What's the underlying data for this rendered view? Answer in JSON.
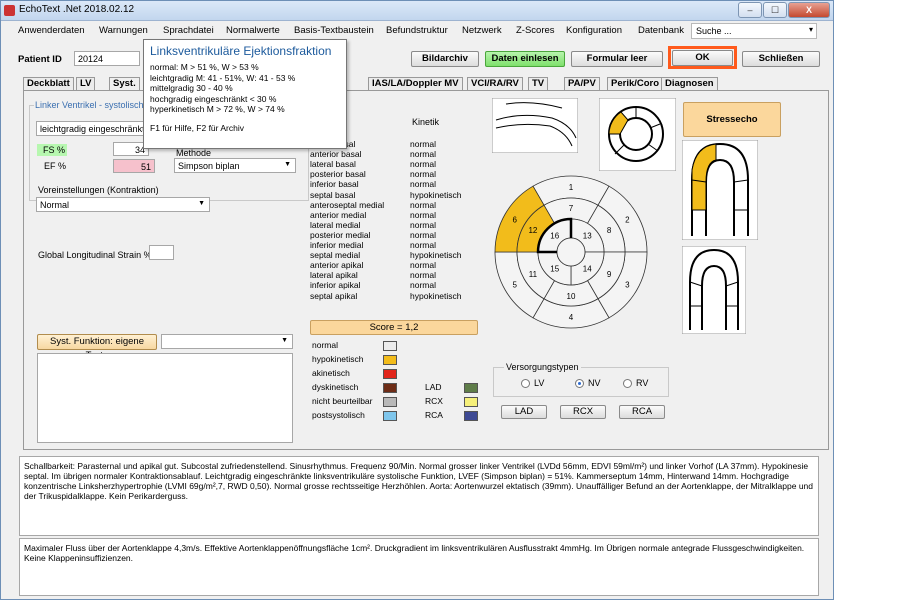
{
  "window": {
    "title": "EchoText .Net 2018.02.12",
    "min": "–",
    "max": "☐",
    "close": "X"
  },
  "menu": [
    "Anwenderdaten",
    "Warnungen",
    "Sprachdatei",
    "Normalwerte",
    "Basis-Textbaustein",
    "Befundstruktur",
    "Netzwerk",
    "Z-Scores",
    "Konfiguration",
    "Datenbank"
  ],
  "search": {
    "value": "Suche ..."
  },
  "patient": {
    "label": "Patient ID",
    "value": "20124"
  },
  "toolbar": {
    "bildarchiv": "Bildarchiv",
    "daten": "Daten einlesen",
    "formular": "Formular leer",
    "ok": "OK",
    "schliessen": "Schließen"
  },
  "tabs": [
    "Deckblatt",
    "LV",
    "Syst.",
    "IAS/LA/Doppler MV",
    "VCI/RA/RV",
    "TV",
    "PA/PV",
    "Perik/Coro",
    "Diagnosen"
  ],
  "tooltip": {
    "title": "Linksventrikuläre Ejektionsfraktion",
    "lines": [
      "normal: M > 51 %, W > 53 %",
      "leichtgradig M: 41 - 51%, W: 41 - 53 %",
      "mittelgradig 30 - 40 %",
      "hochgradig eingeschränkt < 30 %",
      "hyperkinetisch M > 72 %, W > 74 %"
    ],
    "hint": "F1 für Hilfe, F2 für Archiv"
  },
  "left": {
    "group": "Linker Ventrikel - systolische",
    "assessment": "leichtgradig eingeschränkt",
    "fs_label": "FS %",
    "fs_value": "34",
    "ef_label": "EF %",
    "ef_value": "51",
    "method_label": "Methode",
    "method_value": "Simpson biplan",
    "preset_label": "Voreinstellungen (Kontraktion)",
    "preset_value": "Normal",
    "gls_label": "Global Longitudinal Strain %",
    "gls_value": "",
    "own_text_btn": "Syst. Funktion: eigene Texte"
  },
  "kinetik": {
    "header": "Kinetik",
    "segments": [
      [
        "septal basal",
        "normal"
      ],
      [
        "anterior basal",
        "normal"
      ],
      [
        "lateral basal",
        "normal"
      ],
      [
        "posterior basal",
        "normal"
      ],
      [
        "inferior basal",
        "normal"
      ],
      [
        "septal basal",
        "hypokinetisch"
      ],
      [
        "anteroseptal medial",
        "normal"
      ],
      [
        "anterior medial",
        "normal"
      ],
      [
        "lateral medial",
        "normal"
      ],
      [
        "posterior medial",
        "normal"
      ],
      [
        "inferior medial",
        "normal"
      ],
      [
        "septal medial",
        "hypokinetisch"
      ],
      [
        "anterior apikal",
        "normal"
      ],
      [
        "lateral apikal",
        "normal"
      ],
      [
        "inferior apikal",
        "normal"
      ],
      [
        "septal apikal",
        "hypokinetisch"
      ]
    ]
  },
  "score": "Score = 1,2",
  "legend": [
    [
      "normal",
      "#ececec"
    ],
    [
      "hypokinetisch",
      "#f2bc1b"
    ],
    [
      "akinetisch",
      "#e1251b"
    ],
    [
      "dyskinetisch",
      "#6d2c16"
    ],
    [
      "nicht beurteilbar",
      "#b9b9b9"
    ],
    [
      "postsystolisch",
      "#7fc6ec"
    ]
  ],
  "vessels": [
    [
      "LAD",
      "#5f7d49"
    ],
    [
      "RCX",
      "#f6f07a"
    ],
    [
      "RCA",
      "#3e4a94"
    ]
  ],
  "versorgung": {
    "label": "Versorgungstypen",
    "options": [
      "LV",
      "NV",
      "RV"
    ],
    "selected": "NV",
    "buttons": [
      "LAD",
      "RCX",
      "RCA"
    ]
  },
  "stressecho": "Stressecho",
  "bullseye": {
    "labels": [
      "1",
      "2",
      "3",
      "4",
      "5",
      "6",
      "7",
      "8",
      "9",
      "10",
      "11",
      "12",
      "13",
      "14",
      "15",
      "16"
    ]
  },
  "report1": "Schallbarkeit: Parasternal und apikal gut. Subcostal zufriedenstellend. Sinusrhythmus. Frequenz 90/Min. Normal grosser linker Ventrikel (LVDd 56mm, EDVI 59ml/m²) und linker Vorhof (LA 37mm). Hypokinesie septal. Im übrigen normaler Kontraktionsablauf. Leichtgradig eingeschränkte linksventrikuläre systolische Funktion, LVEF (Simpson biplan) = 51%. Kammerseptum 14mm, Hinterwand 14mm. Hochgradige konzentrische Linksherzhypertrophie (LVMI 69g/m²,7, RWD 0,50). Normal grosse rechtsseitige Herzhöhlen. Aorta: Aortenwurzel ektatisch (39mm). Unauffälliger Befund an der Aortenklappe, der Mitralklappe und der Trikuspidalklappe. Kein Perikarderguss.",
  "report2": "Maximaler Fluss über der Aortenklappe 4,3m/s. Effektive Aortenklappenöffnungsfläche 1cm². Druckgradient im linksventrikulären Ausflusstrakt 4mmHg. Im Übrigen normale antegrade Flussgeschwindigkeiten. Keine Klappeninsuffizienzen."
}
